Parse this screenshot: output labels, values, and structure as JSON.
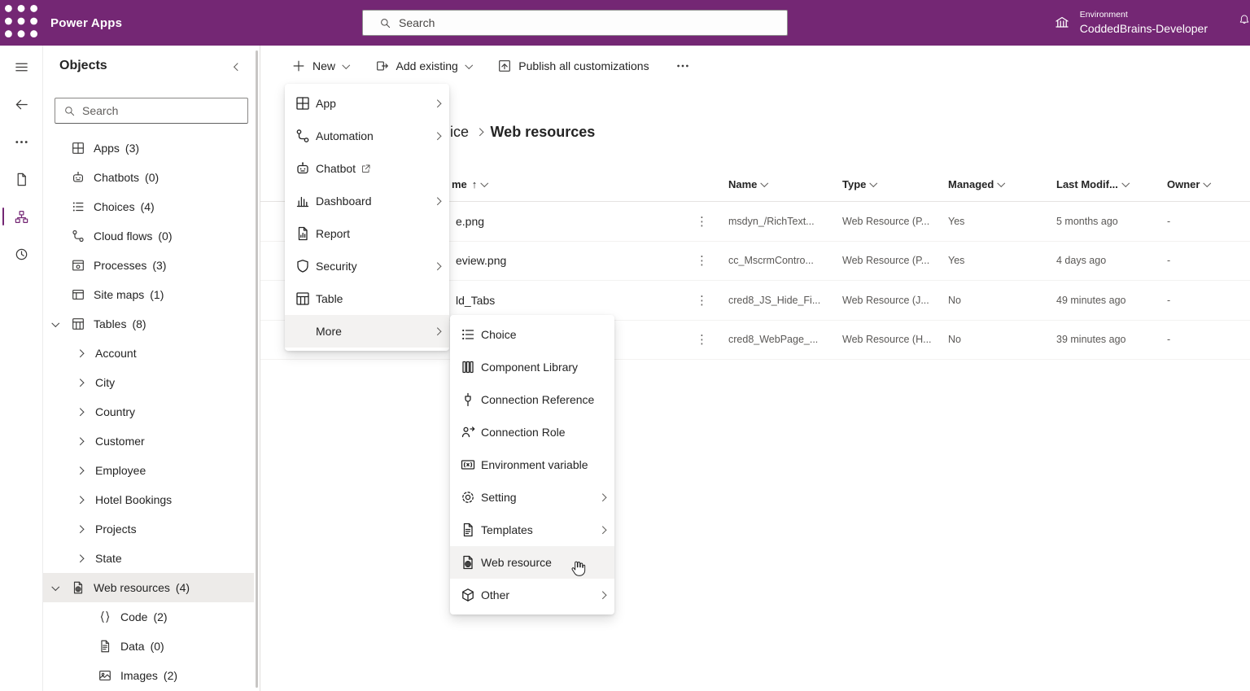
{
  "colors": {
    "brand": "#742774",
    "selected_bg": "#edebe9",
    "hover_bg": "#f3f2f1"
  },
  "header": {
    "app_name": "Power Apps",
    "search_placeholder": "Search",
    "environment_label": "Environment",
    "environment_name": "CoddedBrains-Developer"
  },
  "nav_rail": {
    "items": [
      {
        "name": "menu-toggle",
        "icon": "hamburger"
      },
      {
        "name": "back",
        "icon": "arrow-left"
      },
      {
        "name": "more",
        "icon": "dots-h"
      },
      {
        "name": "pages",
        "icon": "doc"
      },
      {
        "name": "objects",
        "icon": "hierarchy",
        "selected": true
      },
      {
        "name": "history",
        "icon": "clock"
      }
    ]
  },
  "sidebar": {
    "title": "Objects",
    "search_placeholder": "Search",
    "tree": [
      {
        "label": "Apps",
        "count": "(3)",
        "icon": "apps",
        "level": 1
      },
      {
        "label": "Chatbots",
        "count": "(0)",
        "icon": "chatbot",
        "level": 1
      },
      {
        "label": "Choices",
        "count": "(4)",
        "icon": "choices",
        "level": 1
      },
      {
        "label": "Cloud flows",
        "count": "(0)",
        "icon": "flow",
        "level": 1
      },
      {
        "label": "Processes",
        "count": "(3)",
        "icon": "process",
        "level": 1
      },
      {
        "label": "Site maps",
        "count": "(1)",
        "icon": "sitemap",
        "level": 1
      },
      {
        "label": "Tables",
        "count": "(8)",
        "icon": "table",
        "level": 1,
        "expanded": true
      },
      {
        "label": "Account",
        "level": 2
      },
      {
        "label": "City",
        "level": 2
      },
      {
        "label": "Country",
        "level": 2
      },
      {
        "label": "Customer",
        "level": 2
      },
      {
        "label": "Employee",
        "level": 2
      },
      {
        "label": "Hotel Bookings",
        "level": 2
      },
      {
        "label": "Projects",
        "level": 2
      },
      {
        "label": "State",
        "level": 2
      },
      {
        "label": "Web resources",
        "count": "(4)",
        "icon": "webres",
        "level": 1,
        "expanded": true,
        "selected": true
      },
      {
        "label": "Code",
        "count": "(2)",
        "icon": "code",
        "level": 3
      },
      {
        "label": "Data",
        "count": "(0)",
        "icon": "docline",
        "level": 3
      },
      {
        "label": "Images",
        "count": "(2)",
        "icon": "image",
        "level": 3
      }
    ]
  },
  "command_bar": {
    "new_label": "New",
    "add_existing_label": "Add existing",
    "publish_label": "Publish all customizations"
  },
  "breadcrumb": {
    "fragment": "ice",
    "current": "Web resources"
  },
  "table": {
    "sort_glyph": "↑",
    "actions_glyph": "⋮",
    "columns": [
      "me",
      "Name",
      "Type",
      "Managed",
      "Last Modif...",
      "Owner"
    ],
    "rows": [
      {
        "display": "e.png",
        "name": "msdyn_/RichText...",
        "type": "Web Resource (P...",
        "managed": "Yes",
        "modified": "5 months ago",
        "owner": "-"
      },
      {
        "display": "eview.png",
        "name": "cc_MscrmContro...",
        "type": "Web Resource (P...",
        "managed": "Yes",
        "modified": "4 days ago",
        "owner": "-"
      },
      {
        "display": "ld_Tabs",
        "name": "cred8_JS_Hide_Fi...",
        "type": "Web Resource (J...",
        "managed": "No",
        "modified": "49 minutes ago",
        "owner": "-"
      },
      {
        "display": "",
        "name": "cred8_WebPage_...",
        "type": "Web Resource (H...",
        "managed": "No",
        "modified": "39 minutes ago",
        "owner": "-"
      }
    ]
  },
  "new_menu": {
    "items": [
      {
        "label": "App",
        "icon": "apps",
        "submenu": true
      },
      {
        "label": "Automation",
        "icon": "automation",
        "submenu": true
      },
      {
        "label": "Chatbot",
        "icon": "chatbot",
        "external": true
      },
      {
        "label": "Dashboard",
        "icon": "dashboard",
        "submenu": true
      },
      {
        "label": "Report",
        "icon": "report"
      },
      {
        "label": "Security",
        "icon": "security",
        "submenu": true
      },
      {
        "label": "Table",
        "icon": "table"
      },
      {
        "label": "More",
        "submenu": true,
        "highlighted": true
      }
    ]
  },
  "more_menu": {
    "items": [
      {
        "label": "Choice",
        "icon": "choices"
      },
      {
        "label": "Component Library",
        "icon": "component"
      },
      {
        "label": "Connection Reference",
        "icon": "connection-ref"
      },
      {
        "label": "Connection Role",
        "icon": "connection-role"
      },
      {
        "label": "Environment variable",
        "icon": "envvar"
      },
      {
        "label": "Setting",
        "icon": "setting",
        "submenu": true
      },
      {
        "label": "Templates",
        "icon": "template",
        "submenu": true
      },
      {
        "label": "Web resource",
        "icon": "webres",
        "highlighted": true
      },
      {
        "label": "Other",
        "icon": "other",
        "submenu": true
      }
    ]
  }
}
